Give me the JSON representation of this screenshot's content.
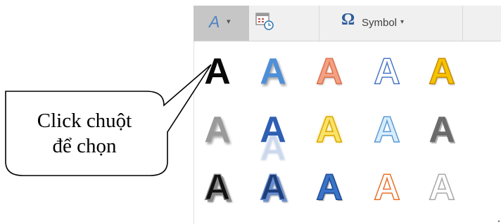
{
  "toolbar": {
    "wordart_glyph": "A",
    "wordart_icon": "wordart-text-icon",
    "caret": "▾",
    "datetime_icon": "date-time-icon",
    "symbol_glyph": "Ω",
    "symbol_label": "Symbol"
  },
  "gallery": {
    "letter": "A",
    "styles": [
      {
        "fill": "#0a0a0a",
        "stroke": "none",
        "effect": "none"
      },
      {
        "fill": "#4f8fd8",
        "stroke": "none",
        "effect": "shadow"
      },
      {
        "fill": "#f3a183",
        "stroke": "#e0704a",
        "effect": "gradient"
      },
      {
        "fill": "#ffffff",
        "stroke": "#4a78c8",
        "effect": "outline"
      },
      {
        "fill": "#f5c300",
        "stroke": "#c98a00",
        "effect": "gradient"
      },
      {
        "fill": "#9a9a9a",
        "stroke": "none",
        "effect": "shadow"
      },
      {
        "fill": "#2f5fb3",
        "stroke": "none",
        "effect": "reflection"
      },
      {
        "fill": "#fbe36a",
        "stroke": "#d9a800",
        "effect": "glow"
      },
      {
        "fill": "#d8ecfb",
        "stroke": "#5b9bd5",
        "effect": "outline"
      },
      {
        "fill": "#6b6b6b",
        "stroke": "none",
        "effect": "bevel"
      },
      {
        "fill": "#111111",
        "stroke": "#888888",
        "effect": "3d"
      },
      {
        "fill": "#1f3f7a",
        "stroke": "#6a8fd0",
        "effect": "3d"
      },
      {
        "fill": "#3a74c9",
        "stroke": "#1d4e9a",
        "effect": "bevel"
      },
      {
        "fill": "#ffffff",
        "stroke": "#e8702a",
        "effect": "outline"
      },
      {
        "fill": "#ffffff",
        "stroke": "#a8a8a8",
        "effect": "outline"
      }
    ]
  },
  "callout": {
    "line1": "Click chuột",
    "line2": "để chọn"
  }
}
